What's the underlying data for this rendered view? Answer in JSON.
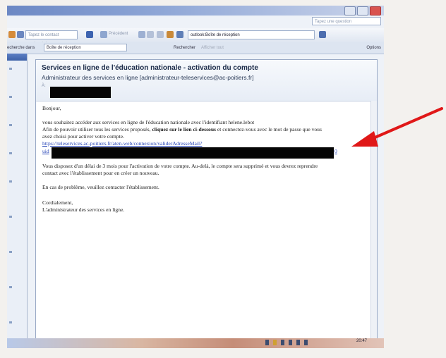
{
  "toolbar": {
    "question_placeholder": "Tapez une question",
    "contact_placeholder": "Tapez le contact recherché",
    "back_label": "Précédent",
    "path_value": "outlook:Boîte de réception"
  },
  "searchbar": {
    "search_in_label": "echerche dans",
    "folder_value": "Boîte de réception",
    "search_label": "Rechercher",
    "show_all_label": "Afficher tout",
    "options_label": "Options"
  },
  "message": {
    "subject": "Services en ligne de l'éducation nationale - activation du compte",
    "sender": "Administrateur des services en ligne [administrateur-teleservices@ac-poitiers.fr]",
    "to_label": "À:",
    "greeting": "Bonjour,",
    "line1": "vous souhaitez accéder aux services en ligne de l'éducation nationale avec l'identifiant helene.lebot",
    "line2_pre": "Afin de pouvoir utiliser tous les services proposés, ",
    "line2_bold": "cliquez sur le lien ci-dessous",
    "line2_post": " et connectez-vous avec le mot de passe que vous",
    "line3": "avez choisi pour activer votre compte.",
    "link": "https://teleservices.ac-poitiers.fr/aten-web/connexion/validerAdresseMail?",
    "link_cont": "uid",
    "link_end": "0",
    "line4": "Vous disposez d'un délai de 3 mois pour l'activation de votre compte. Au-delà, le compte sera supprimé et vous devrez reprendre",
    "line5": "contact avec l'établissement pour en créer un nouveau.",
    "line6": "En cas de problème, veuillez contacter l'établissement.",
    "closing": "Cordialement,",
    "signature": "L'administrateur des services en ligne."
  },
  "taskbar": {
    "clock": "20:47"
  },
  "colors": {
    "arrow": "#e01818",
    "link": "#2a47b8",
    "subject": "#1a2a48"
  }
}
